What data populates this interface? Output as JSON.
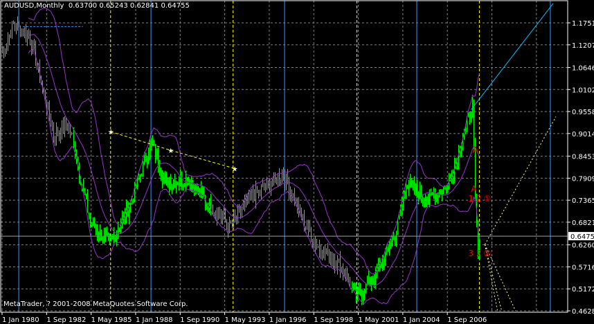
{
  "header": {
    "symbol": "AUDUSD,Monthly",
    "open": "0.63700",
    "high": "0.65243",
    "low": "0.62841",
    "close": "0.64755"
  },
  "footer": {
    "copyright": "MetaTrader, ? 2001-2008 MetaQuotes Software Corp."
  },
  "colors": {
    "background": "#000000",
    "bars": "#00ff00",
    "bands": "#9933cc",
    "grid": "#808080",
    "trendline_cyan": "#00bfff",
    "vertical_blue": "#3399ff",
    "yellow": "#ffff00",
    "annotations": "#ff0000",
    "axis": "#ffffff"
  },
  "chart_data": {
    "type": "bar",
    "subtype": "ohlc",
    "symbol": "AUDUSD",
    "timeframe": "Monthly",
    "x_start": "1980-01",
    "x_end": "2013-03",
    "ylim": [
      0.4628,
      1.1751
    ],
    "grid": true,
    "y_ticks": [
      "1.17510",
      "1.12070",
      "1.06460",
      "1.01020",
      "0.95580",
      "0.90140",
      "0.84530",
      "0.79090",
      "0.73650",
      "0.68210",
      "0.62600",
      "0.57160",
      "0.51720",
      "0.46280"
    ],
    "x_ticks": [
      {
        "label": "1 Jan 1980",
        "date": "1980-01"
      },
      {
        "label": "1 Sep 1982",
        "date": "1982-09"
      },
      {
        "label": "1 May 1985",
        "date": "1985-05"
      },
      {
        "label": "1 Jan 1988",
        "date": "1988-01"
      },
      {
        "label": "1 Sep 1990",
        "date": "1990-09"
      },
      {
        "label": "1 May 1993",
        "date": "1993-05"
      },
      {
        "label": "1 Jan 1996",
        "date": "1996-01"
      },
      {
        "label": "1 Sep 1998",
        "date": "1998-09"
      },
      {
        "label": "1 May 2001",
        "date": "2001-05"
      },
      {
        "label": "1 Jan 2004",
        "date": "2004-01"
      },
      {
        "label": "1 Sep 2006",
        "date": "2006-09"
      }
    ],
    "current_price": "0.64755",
    "price_path": [
      [
        "1980-01",
        1.1
      ],
      [
        "1980-09",
        1.17
      ],
      [
        "1981-09",
        1.14
      ],
      [
        "1983-02",
        0.9
      ],
      [
        "1984-01",
        0.92
      ],
      [
        "1985-04",
        0.68
      ],
      [
        "1986-06",
        0.63
      ],
      [
        "1987-08",
        0.72
      ],
      [
        "1988-12",
        0.88
      ],
      [
        "1989-10",
        0.78
      ],
      [
        "1991-02",
        0.79
      ],
      [
        "1992-05",
        0.73
      ],
      [
        "1993-08",
        0.67
      ],
      [
        "1994-10",
        0.74
      ],
      [
        "1996-11",
        0.8
      ],
      [
        "1998-02",
        0.68
      ],
      [
        "1998-12",
        0.62
      ],
      [
        "2000-03",
        0.58
      ],
      [
        "2001-04",
        0.5
      ],
      [
        "2002-05",
        0.55
      ],
      [
        "2003-08",
        0.66
      ],
      [
        "2004-03",
        0.78
      ],
      [
        "2005-06",
        0.74
      ],
      [
        "2006-09",
        0.77
      ],
      [
        "2008-01",
        0.95
      ],
      [
        "2008-03",
        0.97
      ],
      [
        "2008-05",
        0.74
      ],
      [
        "2008-07",
        0.6
      ],
      [
        "2008-08",
        0.6475
      ]
    ],
    "indicator": {
      "name": "Bollinger Bands",
      "period": 20,
      "deviations": 2
    },
    "objects": {
      "cyan_trendline": [
        [
          "2008-02",
          0.96
        ],
        [
          "2013-01",
          1.223
        ]
      ],
      "yellow_trendline": [
        [
          "1986-07",
          0.906
        ],
        [
          "1990-02",
          0.86
        ],
        [
          "1993-12",
          0.815
        ]
      ],
      "blue_dashed_hline": {
        "price": 1.166,
        "from": "1981-04",
        "to": "1984-11"
      },
      "blue_vlines": [
        "1981-01",
        "1988-12",
        "1996-12",
        "2004-11",
        "2012-11"
      ],
      "yellow_vlines": [
        "1986-07",
        "1993-11",
        "2001-04",
        "2008-08"
      ],
      "yellow_fan": {
        "origin": [
          "2008-12",
          0.627
        ],
        "targets": [
          [
            "2013-03",
            0.943
          ],
          [
            "2009-09",
            0.4628
          ],
          [
            "2009-12",
            0.4628
          ],
          [
            "2010-10",
            0.4628
          ]
        ]
      }
    },
    "annotations": [
      {
        "text": "A",
        "date": "2008-06",
        "price": 0.86
      },
      {
        "text": "A",
        "date": "2008-05",
        "price": 0.765
      },
      {
        "text": "1 2",
        "date": "2008-03",
        "price": 0.74
      },
      {
        "text": "①",
        "date": "2009-02",
        "price": 0.74
      },
      {
        "text": "3 2 1",
        "date": "2008-03",
        "price": 0.605
      },
      {
        "text": "②",
        "date": "2009-02",
        "price": 0.605
      }
    ]
  }
}
